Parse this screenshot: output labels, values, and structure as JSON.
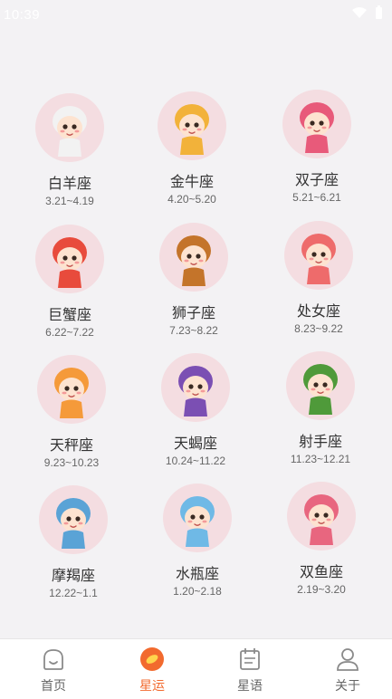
{
  "status_bar": {
    "time": "10:39"
  },
  "signs": [
    {
      "name": "白羊座",
      "dates": "3.21~4.19",
      "icon": "aries-mascot-icon",
      "color": "#f2f2f2"
    },
    {
      "name": "金牛座",
      "dates": "4.20~5.20",
      "icon": "taurus-mascot-icon",
      "color": "#f2b23a"
    },
    {
      "name": "双子座",
      "dates": "5.21~6.21",
      "icon": "gemini-mascot-icon",
      "color": "#e85a7a"
    },
    {
      "name": "巨蟹座",
      "dates": "6.22~7.22",
      "icon": "cancer-mascot-icon",
      "color": "#e84b3c"
    },
    {
      "name": "狮子座",
      "dates": "7.23~8.22",
      "icon": "leo-mascot-icon",
      "color": "#c4742a"
    },
    {
      "name": "处女座",
      "dates": "8.23~9.22",
      "icon": "virgo-mascot-icon",
      "color": "#ee6b6b"
    },
    {
      "name": "天秤座",
      "dates": "9.23~10.23",
      "icon": "libra-mascot-icon",
      "color": "#f59a3a"
    },
    {
      "name": "天蝎座",
      "dates": "10.24~11.22",
      "icon": "scorpio-mascot-icon",
      "color": "#7b4fb3"
    },
    {
      "name": "射手座",
      "dates": "11.23~12.21",
      "icon": "sagittarius-mascot-icon",
      "color": "#4f9a3a"
    },
    {
      "name": "摩羯座",
      "dates": "12.22~1.1",
      "icon": "capricorn-mascot-icon",
      "color": "#5aa3d6"
    },
    {
      "name": "水瓶座",
      "dates": "1.20~2.18",
      "icon": "aquarius-mascot-icon",
      "color": "#6fb9e6"
    },
    {
      "name": "双鱼座",
      "dates": "2.19~3.20",
      "icon": "pisces-mascot-icon",
      "color": "#e8667f"
    }
  ],
  "tabs": [
    {
      "label": "首页",
      "icon": "home-icon",
      "active": false
    },
    {
      "label": "星运",
      "icon": "fortune-icon",
      "active": true
    },
    {
      "label": "星语",
      "icon": "calendar-icon",
      "active": false
    },
    {
      "label": "关于",
      "icon": "user-icon",
      "active": false
    }
  ],
  "colors": {
    "accent": "#f26a2e",
    "avatar_bg": "#f4dde1",
    "page_bg": "#f3f2f4"
  }
}
